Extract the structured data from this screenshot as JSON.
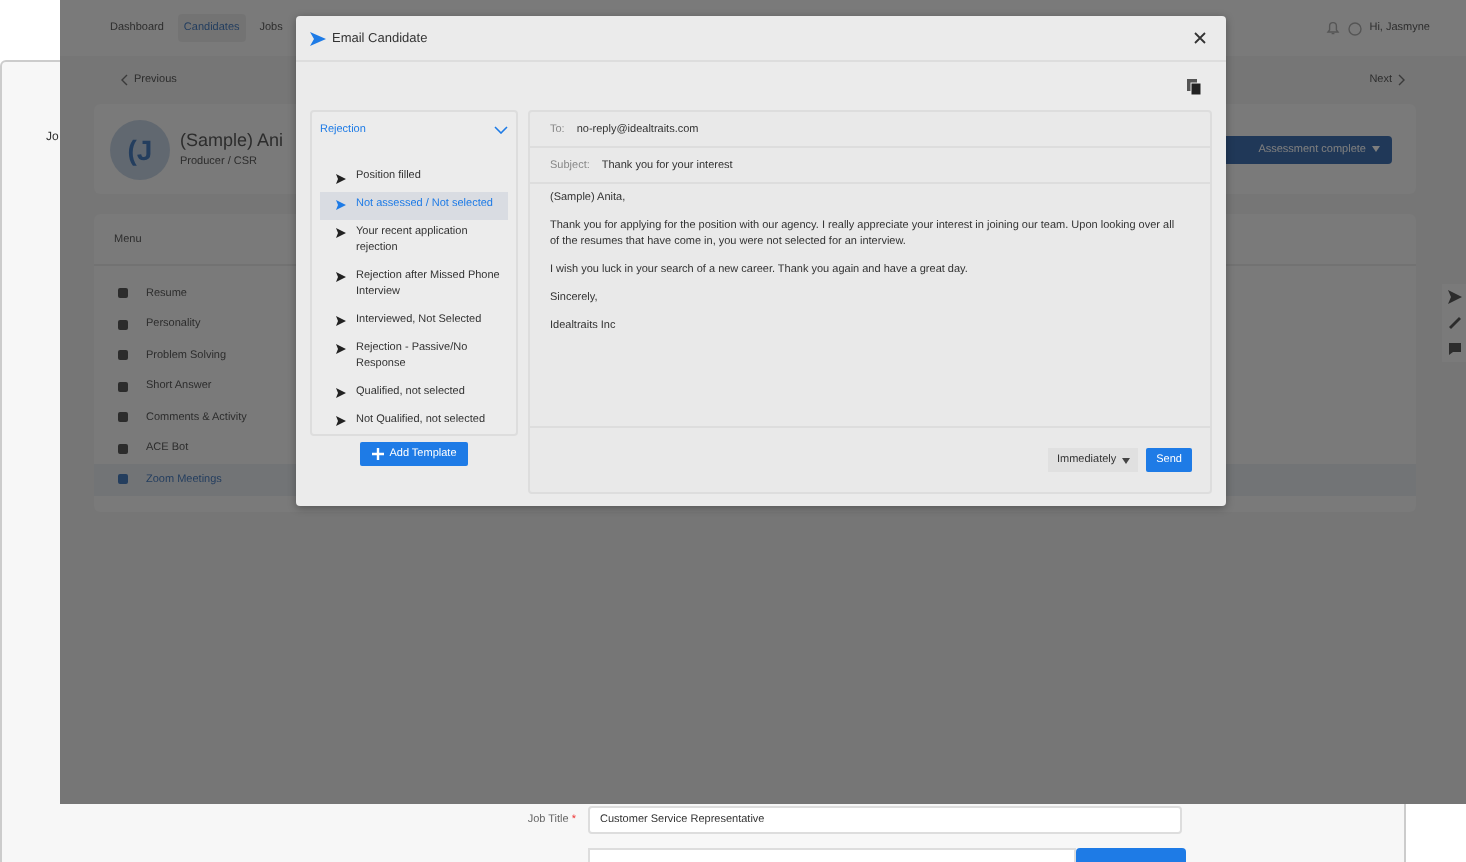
{
  "back_page": {
    "heading_fragment": "Jo",
    "job_title_label": "Job Title",
    "required_mark": "*",
    "job_title_value": "Customer Service Representative"
  },
  "nav": {
    "items": [
      {
        "label": "Dashboard",
        "selected": false
      },
      {
        "label": "Candidates",
        "selected": true
      },
      {
        "label": "Jobs",
        "selected": false
      }
    ],
    "greeting": "Hi, Jasmyne"
  },
  "pager": {
    "previous": "Previous",
    "next": "Next"
  },
  "profile": {
    "avatar_initials": "(J",
    "name": "(Sample) Ani",
    "role": "Producer / CSR",
    "assessment_button": "Assessment complete"
  },
  "menu": {
    "title": "Menu",
    "items": [
      {
        "label": "Resume",
        "selected": false
      },
      {
        "label": "Personality",
        "selected": false
      },
      {
        "label": "Problem Solving",
        "selected": false
      },
      {
        "label": "Short Answer",
        "selected": false
      },
      {
        "label": "Comments & Activity",
        "selected": false
      },
      {
        "label": "ACE Bot",
        "selected": false
      },
      {
        "label": "Zoom Meetings",
        "selected": true
      }
    ]
  },
  "modal": {
    "title": "Email Candidate",
    "category": "Rejection",
    "templates": [
      {
        "label": "Position filled",
        "selected": false
      },
      {
        "label": "Not assessed / Not selected",
        "selected": true
      },
      {
        "label": "Your recent application rejection",
        "selected": false
      },
      {
        "label": "Rejection after Missed Phone Interview",
        "selected": false
      },
      {
        "label": "Interviewed, Not Selected",
        "selected": false
      },
      {
        "label": "Rejection - Passive/No Response",
        "selected": false
      },
      {
        "label": "Qualified, not selected",
        "selected": false
      },
      {
        "label": "Not Qualified, not selected",
        "selected": false
      }
    ],
    "add_template": "Add Template",
    "to_label": "To:",
    "to": "no-reply@idealtraits.com",
    "subject_label": "Subject:",
    "subject": "Thank you for your interest",
    "body": [
      "(Sample) Anita,",
      "Thank you for applying for the position with our agency.  I really appreciate your interest in joining our team.  Upon looking over all of the resumes that have come in, you were not selected for an interview.",
      "I wish you luck in your search of a new career.  Thank you again and have a great day.",
      "Sincerely,",
      "Idealtraits Inc"
    ],
    "schedule": "Immediately",
    "send": "Send"
  }
}
